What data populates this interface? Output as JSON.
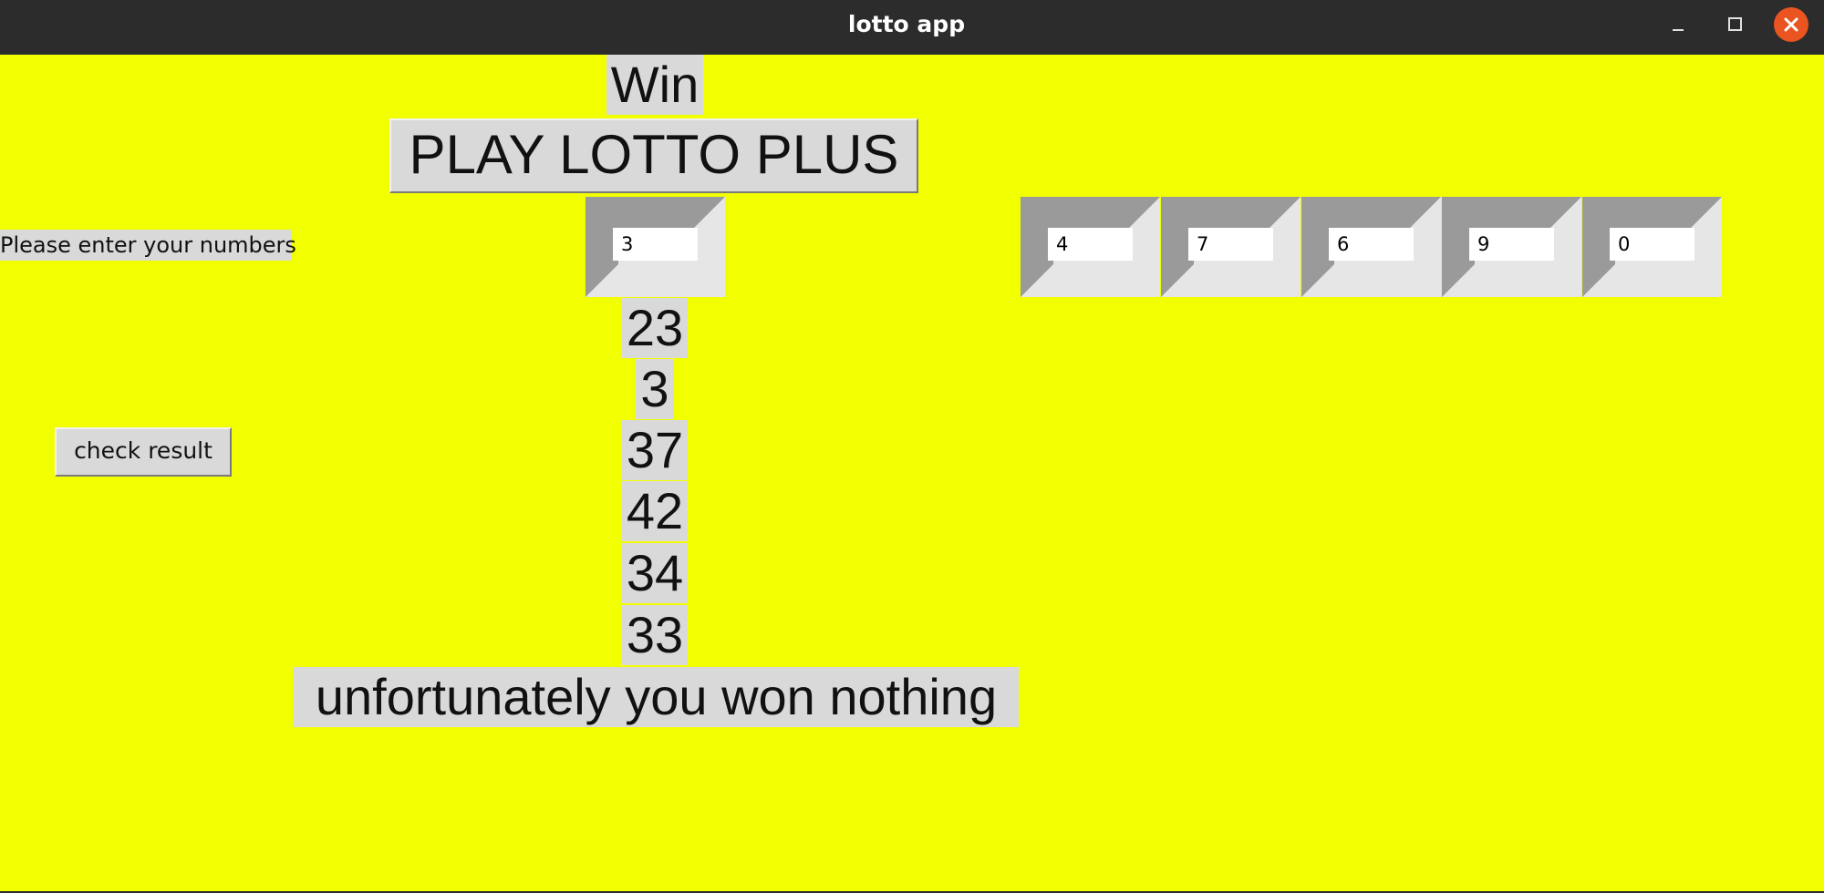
{
  "window": {
    "title": "lotto app"
  },
  "app": {
    "win_label": "Win",
    "play_button_label": "PLAY LOTTO PLUS",
    "prompt_label": "Please enter your numbers",
    "check_button_label": "check result",
    "entries": [
      "3",
      "4",
      "7",
      "6",
      "9",
      "0"
    ],
    "drawn_numbers": [
      "23",
      "3",
      "37",
      "42",
      "34",
      "33"
    ],
    "outcome_message": "unfortunately you won nothing"
  },
  "colors": {
    "background": "#f2ff00",
    "widget": "#d9d9d9",
    "close_button": "#e95420"
  }
}
